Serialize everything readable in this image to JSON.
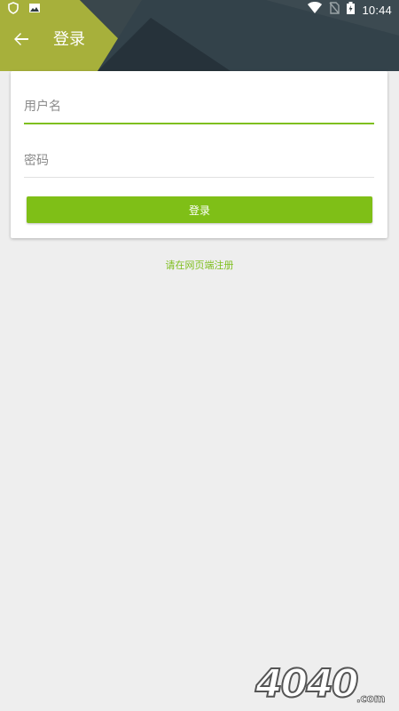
{
  "status_bar": {
    "time": "10:44",
    "left_icons": [
      "shield-icon",
      "image-icon"
    ],
    "right_icons": [
      "wifi-icon",
      "no-sim-icon",
      "battery-icon"
    ]
  },
  "app_bar": {
    "title": "登录",
    "back_icon": "arrow-back-icon"
  },
  "form": {
    "username_placeholder": "用户名",
    "password_placeholder": "密码",
    "username_value": "",
    "password_value": "",
    "login_label": "登录"
  },
  "register_text": "请在网页端注册",
  "watermark": {
    "text": "4040",
    "suffix": ".com"
  },
  "colors": {
    "accent": "#7fbf17",
    "header_dark": "#2f3b40",
    "header_olive": "#a8b23a",
    "background": "#eeeeee"
  }
}
